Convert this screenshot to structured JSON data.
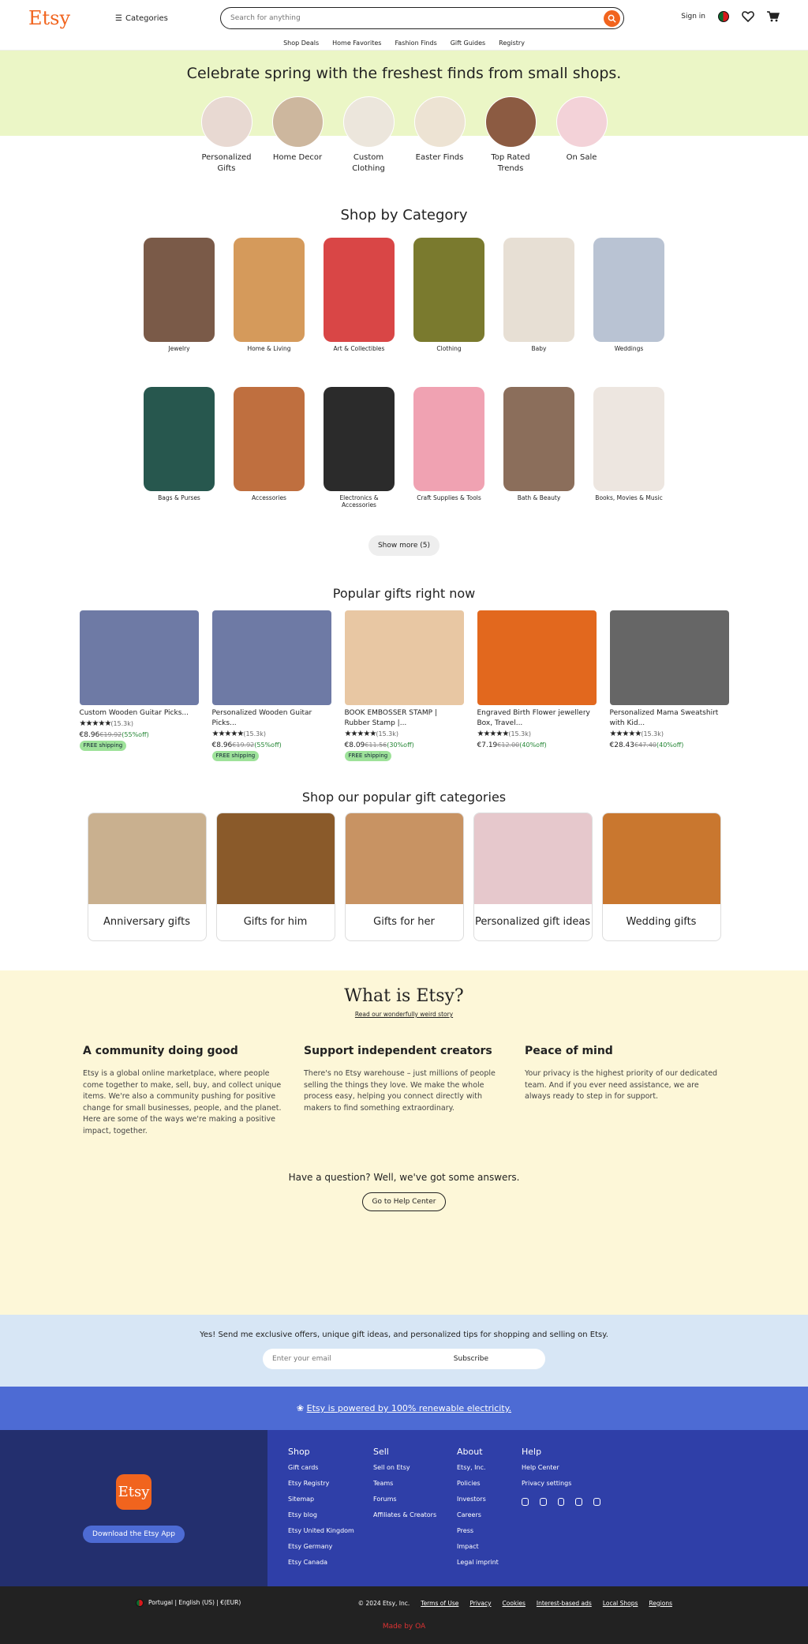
{
  "header": {
    "logo": "Etsy",
    "categories": "Categories",
    "search_placeholder": "Search for anything",
    "signin": "Sign in"
  },
  "subnav": [
    "Shop Deals",
    "Home Favorites",
    "Fashion Finds",
    "Gift Guides",
    "Registry"
  ],
  "hero": {
    "title": "Celebrate spring with the freshest finds from small shops.",
    "circles": [
      {
        "label": "Personalized Gifts",
        "color": "#e8d9d2"
      },
      {
        "label": "Home Decor",
        "color": "#cdb79e"
      },
      {
        "label": "Custom Clothing",
        "color": "#ece6dc"
      },
      {
        "label": "Easter Finds",
        "color": "#ede3d3"
      },
      {
        "label": "Top Rated Trends",
        "color": "#8c5b42"
      },
      {
        "label": "On Sale",
        "color": "#f3d2d8"
      }
    ]
  },
  "category": {
    "title": "Shop by Category",
    "items": [
      {
        "label": "Jewelry",
        "color": "#7a5a48"
      },
      {
        "label": "Home & Living",
        "color": "#d59a5b"
      },
      {
        "label": "Art & Collectibles",
        "color": "#d94646"
      },
      {
        "label": "Clothing",
        "color": "#7a7a2e"
      },
      {
        "label": "Baby",
        "color": "#e7dfd4"
      },
      {
        "label": "Weddings",
        "color": "#b9c3d3"
      },
      {
        "label": "Bags & Purses",
        "color": "#27574e"
      },
      {
        "label": "Accessories",
        "color": "#bf6f3f"
      },
      {
        "label": "Electronics & Accessories",
        "color": "#2b2b2b"
      },
      {
        "label": "Craft Supplies & Tools",
        "color": "#f0a2b2"
      },
      {
        "label": "Bath & Beauty",
        "color": "#8b6e5b"
      },
      {
        "label": "Books, Movies & Music",
        "color": "#ede6e0"
      }
    ],
    "show_more": "Show more (5)"
  },
  "popular": {
    "title": "Popular gifts right now",
    "items": [
      {
        "title": "Custom Wooden Guitar Picks...",
        "reviews": "(15.3k)",
        "price": "€8.96",
        "old": "€19.92",
        "off": "(55%off)",
        "ship": "FREE shipping",
        "color": "#6e7aa5"
      },
      {
        "title": "Personalized Wooden Guitar Picks...",
        "reviews": "(15.3k)",
        "price": "€8.96",
        "old": "€19.92",
        "off": "(55%off)",
        "ship": "FREE shipping",
        "color": "#6e7aa5"
      },
      {
        "title": "BOOK EMBOSSER STAMP | Rubber Stamp |...",
        "reviews": "(15.3k)",
        "price": "€8.09",
        "old": "€11.56",
        "off": "(30%off)",
        "ship": "FREE shipping",
        "color": "#e8c7a3"
      },
      {
        "title": "Engraved Birth Flower jewellery Box, Travel...",
        "reviews": "(15.3k)",
        "price": "€7.19",
        "old": "€12.00",
        "off": "(40%off)",
        "ship": "",
        "color": "#e2681e"
      },
      {
        "title": "Personalized Mama Sweatshirt with Kid...",
        "reviews": "(15.3k)",
        "price": "€28.43",
        "old": "€47.40",
        "off": "(40%off)",
        "ship": "",
        "color": "#666"
      }
    ],
    "stars": "★★★★★"
  },
  "gift_cats": {
    "title": "Shop our popular gift categories",
    "items": [
      {
        "label": "Anniversary gifts",
        "color": "#c9b08f"
      },
      {
        "label": "Gifts for him",
        "color": "#8a5a2a"
      },
      {
        "label": "Gifts for her",
        "color": "#c89363"
      },
      {
        "label": "Personalized gift ideas",
        "color": "#e6c8cc"
      },
      {
        "label": "Wedding gifts",
        "color": "#c9772f"
      }
    ]
  },
  "what": {
    "title": "What is Etsy?",
    "link": "Read our wonderfully weird story",
    "cols": [
      {
        "h": "A community doing good",
        "p": "Etsy is a global online marketplace, where people come together to make, sell, buy, and collect unique items. We're also a community pushing for positive change for small businesses, people, and the planet. Here are some of the ways we're making a positive impact, together."
      },
      {
        "h": "Support independent creators",
        "p": "There's no Etsy warehouse – just millions of people selling the things they love. We make the whole process easy, helping you connect directly with makers to find something extraordinary."
      },
      {
        "h": "Peace of mind",
        "p": "Your privacy is the highest priority of our dedicated team. And if you ever need assistance, we are always ready to step in for support."
      }
    ],
    "question": "Have a question? Well, we've got some answers.",
    "help_btn": "Go to Help Center"
  },
  "newsletter": {
    "text": "Yes! Send me exclusive offers, unique gift ideas, and personalized tips for shopping and selling on Etsy.",
    "placeholder": "Enter your email",
    "subscribe": "Subscribe"
  },
  "renew": "Etsy is powered by 100% renewable electricity.",
  "footer": {
    "app_btn": "Download the Etsy App",
    "logo": "Etsy",
    "cols": [
      {
        "h": "Shop",
        "items": [
          "Gift cards",
          "Etsy Registry",
          "Sitemap",
          "Etsy blog",
          "Etsy United Kingdom",
          "Etsy Germany",
          "Etsy Canada"
        ]
      },
      {
        "h": "Sell",
        "items": [
          "Sell on Etsy",
          "Teams",
          "Forums",
          "Affiliates & Creators"
        ]
      },
      {
        "h": "About",
        "items": [
          "Etsy, Inc.",
          "Policies",
          "Investors",
          "Careers",
          "Press",
          "Impact",
          "Legal imprint"
        ]
      },
      {
        "h": "Help",
        "items": [
          "Help Center",
          "Privacy settings"
        ]
      }
    ]
  },
  "bottom": {
    "region": "Portugal | English (US) | €(EUR)",
    "copy": "© 2024 Etsy, Inc.",
    "links": [
      "Terms of Use",
      "Privacy",
      "Cookies",
      "Interest-based ads",
      "Local Shops",
      "Regions"
    ],
    "made": "Made by OA"
  }
}
